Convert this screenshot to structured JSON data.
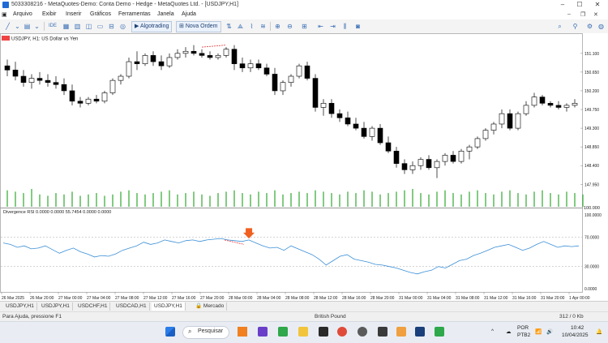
{
  "window": {
    "title": "5033308216 - MetaQuotes-Demo: Conta Demo - Hedge - MetaQuotes Ltd. - [USDJPY,H1]",
    "minimize": "–",
    "maximize": "☐",
    "close": "✕"
  },
  "menu": {
    "items": [
      "Arquivo",
      "Exibir",
      "Inserir",
      "Gráficos",
      "Ferramentas",
      "Janela",
      "Ajuda"
    ],
    "controls": {
      "minimize": "–",
      "restore": "❐",
      "close": "✕"
    }
  },
  "toolbar": {
    "algotrading_label": "Algotrading",
    "new_order_label": "Nova Ordem",
    "accent": "#1d3f72"
  },
  "chart": {
    "header": "USDJPY, H1: US Dollar vs Yen",
    "price_labels": [
      "151.100",
      "150.650",
      "150.200",
      "149.750",
      "149.300",
      "148.850",
      "148.400",
      "147.950"
    ],
    "volume_scale": "100.000",
    "indicator_header": "Divergence RSI 0.0000 0.0000 55.7454 0.0000 0.0000",
    "indicator_scale": [
      "100.0000",
      "70.0000",
      "30.0000",
      "0.0000"
    ],
    "time_labels": [
      "26 Mar 2025",
      "26 Mar 20:00",
      "27 Mar 00:00",
      "27 Mar 04:00",
      "27 Mar 08:00",
      "27 Mar 12:00",
      "27 Mar 16:00",
      "27 Mar 20:00",
      "28 Mar 00:00",
      "28 Mar 04:00",
      "28 Mar 08:00",
      "28 Mar 12:00",
      "28 Mar 16:00",
      "28 Mar 20:00",
      "31 Mar 00:00",
      "31 Mar 04:00",
      "31 Mar 08:00",
      "31 Mar 12:00",
      "31 Mar 16:00",
      "31 Mar 20:00",
      "1 Apr 00:00"
    ],
    "colors": {
      "bull": "#ffffff",
      "bear": "#000000",
      "volume": "#2ea82e",
      "rsi": "#3b8fd6",
      "divergence": "#e33a3a",
      "arrow": "#f06020"
    }
  },
  "chart_data": {
    "type": "candlestick",
    "candles": [
      {
        "o": 150.8,
        "h": 150.95,
        "l": 150.55,
        "c": 150.7
      },
      {
        "o": 150.7,
        "h": 150.9,
        "l": 150.45,
        "c": 150.55
      },
      {
        "o": 150.55,
        "h": 150.7,
        "l": 150.3,
        "c": 150.4
      },
      {
        "o": 150.4,
        "h": 150.6,
        "l": 150.25,
        "c": 150.5
      },
      {
        "o": 150.5,
        "h": 150.65,
        "l": 150.35,
        "c": 150.45
      },
      {
        "o": 150.45,
        "h": 150.6,
        "l": 150.3,
        "c": 150.4
      },
      {
        "o": 150.4,
        "h": 150.55,
        "l": 150.25,
        "c": 150.35
      },
      {
        "o": 150.35,
        "h": 150.5,
        "l": 150.1,
        "c": 150.2
      },
      {
        "o": 150.2,
        "h": 150.35,
        "l": 149.85,
        "c": 149.95
      },
      {
        "o": 149.95,
        "h": 150.05,
        "l": 149.8,
        "c": 149.9
      },
      {
        "o": 149.9,
        "h": 150.05,
        "l": 149.85,
        "c": 150.0
      },
      {
        "o": 150.0,
        "h": 150.1,
        "l": 149.9,
        "c": 149.95
      },
      {
        "o": 149.95,
        "h": 150.2,
        "l": 149.9,
        "c": 150.15
      },
      {
        "o": 150.15,
        "h": 150.5,
        "l": 150.1,
        "c": 150.45
      },
      {
        "o": 150.45,
        "h": 150.6,
        "l": 150.35,
        "c": 150.55
      },
      {
        "o": 150.55,
        "h": 151.0,
        "l": 150.5,
        "c": 150.9
      },
      {
        "o": 150.9,
        "h": 151.15,
        "l": 150.7,
        "c": 150.85
      },
      {
        "o": 150.85,
        "h": 151.1,
        "l": 150.8,
        "c": 151.05
      },
      {
        "o": 151.05,
        "h": 151.15,
        "l": 150.8,
        "c": 150.9
      },
      {
        "o": 150.9,
        "h": 151.05,
        "l": 150.7,
        "c": 150.8
      },
      {
        "o": 150.8,
        "h": 151.1,
        "l": 150.75,
        "c": 151.0
      },
      {
        "o": 151.0,
        "h": 151.2,
        "l": 150.95,
        "c": 151.1
      },
      {
        "o": 151.1,
        "h": 151.25,
        "l": 151.0,
        "c": 151.15
      },
      {
        "o": 151.15,
        "h": 151.3,
        "l": 151.05,
        "c": 151.1
      },
      {
        "o": 151.1,
        "h": 151.2,
        "l": 151.0,
        "c": 151.05
      },
      {
        "o": 151.05,
        "h": 151.15,
        "l": 150.95,
        "c": 151.0
      },
      {
        "o": 151.0,
        "h": 151.1,
        "l": 150.95,
        "c": 151.05
      },
      {
        "o": 151.05,
        "h": 151.25,
        "l": 151.0,
        "c": 151.2
      },
      {
        "o": 151.2,
        "h": 151.3,
        "l": 150.7,
        "c": 150.85
      },
      {
        "o": 150.85,
        "h": 151.0,
        "l": 150.65,
        "c": 150.75
      },
      {
        "o": 150.75,
        "h": 150.95,
        "l": 150.65,
        "c": 150.85
      },
      {
        "o": 150.85,
        "h": 150.95,
        "l": 150.7,
        "c": 150.75
      },
      {
        "o": 150.75,
        "h": 150.85,
        "l": 150.55,
        "c": 150.6
      },
      {
        "o": 150.6,
        "h": 150.75,
        "l": 150.1,
        "c": 150.2
      },
      {
        "o": 150.2,
        "h": 150.45,
        "l": 150.1,
        "c": 150.4
      },
      {
        "o": 150.4,
        "h": 150.6,
        "l": 150.3,
        "c": 150.55
      },
      {
        "o": 150.55,
        "h": 150.85,
        "l": 150.5,
        "c": 150.8
      },
      {
        "o": 150.8,
        "h": 150.9,
        "l": 150.45,
        "c": 150.5
      },
      {
        "o": 150.5,
        "h": 150.6,
        "l": 149.7,
        "c": 149.8
      },
      {
        "o": 149.8,
        "h": 150.0,
        "l": 149.6,
        "c": 149.9
      },
      {
        "o": 149.9,
        "h": 150.0,
        "l": 149.55,
        "c": 149.65
      },
      {
        "o": 149.65,
        "h": 149.75,
        "l": 149.45,
        "c": 149.55
      },
      {
        "o": 149.55,
        "h": 149.7,
        "l": 149.35,
        "c": 149.4
      },
      {
        "o": 149.4,
        "h": 149.55,
        "l": 149.25,
        "c": 149.3
      },
      {
        "o": 149.3,
        "h": 149.45,
        "l": 149.05,
        "c": 149.1
      },
      {
        "o": 149.1,
        "h": 149.35,
        "l": 149.0,
        "c": 149.3
      },
      {
        "o": 149.3,
        "h": 149.4,
        "l": 148.9,
        "c": 148.95
      },
      {
        "o": 148.95,
        "h": 149.1,
        "l": 148.7,
        "c": 148.75
      },
      {
        "o": 148.75,
        "h": 148.85,
        "l": 148.35,
        "c": 148.45
      },
      {
        "o": 148.45,
        "h": 148.55,
        "l": 148.2,
        "c": 148.3
      },
      {
        "o": 148.3,
        "h": 148.5,
        "l": 148.2,
        "c": 148.4
      },
      {
        "o": 148.4,
        "h": 148.6,
        "l": 148.3,
        "c": 148.55
      },
      {
        "o": 148.55,
        "h": 148.65,
        "l": 148.3,
        "c": 148.35
      },
      {
        "o": 148.35,
        "h": 148.55,
        "l": 148.1,
        "c": 148.5
      },
      {
        "o": 148.5,
        "h": 148.7,
        "l": 148.4,
        "c": 148.65
      },
      {
        "o": 148.65,
        "h": 148.75,
        "l": 148.45,
        "c": 148.5
      },
      {
        "o": 148.5,
        "h": 148.8,
        "l": 148.45,
        "c": 148.75
      },
      {
        "o": 148.75,
        "h": 148.9,
        "l": 148.55,
        "c": 148.85
      },
      {
        "o": 148.85,
        "h": 149.1,
        "l": 148.8,
        "c": 149.05
      },
      {
        "o": 149.05,
        "h": 149.3,
        "l": 149.0,
        "c": 149.25
      },
      {
        "o": 149.25,
        "h": 149.45,
        "l": 149.15,
        "c": 149.4
      },
      {
        "o": 149.4,
        "h": 149.75,
        "l": 149.3,
        "c": 149.65
      },
      {
        "o": 149.65,
        "h": 149.75,
        "l": 149.25,
        "c": 149.3
      },
      {
        "o": 149.3,
        "h": 149.7,
        "l": 149.25,
        "c": 149.65
      },
      {
        "o": 149.65,
        "h": 149.95,
        "l": 149.6,
        "c": 149.85
      },
      {
        "o": 149.85,
        "h": 150.15,
        "l": 149.8,
        "c": 150.05
      },
      {
        "o": 150.05,
        "h": 150.1,
        "l": 149.85,
        "c": 149.9
      },
      {
        "o": 149.9,
        "h": 149.95,
        "l": 149.8,
        "c": 149.85
      },
      {
        "o": 149.85,
        "h": 149.95,
        "l": 149.75,
        "c": 149.8
      },
      {
        "o": 149.8,
        "h": 149.9,
        "l": 149.7,
        "c": 149.85
      },
      {
        "o": 149.85,
        "h": 150.0,
        "l": 149.8,
        "c": 149.9
      }
    ],
    "ylim": [
      147.8,
      151.35
    ],
    "volume": [
      60,
      55,
      50,
      65,
      45,
      40,
      50,
      45,
      55,
      40,
      45,
      50,
      40,
      45,
      55,
      60,
      50,
      45,
      50,
      55,
      60,
      45,
      50,
      55,
      45,
      40,
      50,
      55,
      60,
      50,
      45,
      55,
      50,
      60,
      45,
      50,
      55,
      50,
      60,
      55,
      50,
      45,
      55,
      50,
      60,
      55,
      45,
      50,
      55,
      60,
      65,
      50,
      45,
      55,
      60,
      50,
      45,
      55,
      60,
      50,
      45,
      55,
      60,
      50,
      45,
      55,
      60,
      50,
      45,
      55,
      50,
      45
    ],
    "rsi": {
      "ylim": [
        0,
        100
      ],
      "levels": [
        70,
        30
      ],
      "values": [
        62,
        60,
        56,
        58,
        54,
        55,
        58,
        53,
        48,
        52,
        55,
        50,
        47,
        43,
        45,
        44,
        47,
        52,
        55,
        58,
        63,
        60,
        62,
        66,
        64,
        62,
        65,
        66,
        64,
        66,
        67,
        68,
        66,
        65,
        64,
        66,
        62,
        58,
        55,
        56,
        52,
        58,
        54,
        50,
        46,
        40,
        32,
        38,
        44,
        46,
        40,
        38,
        36,
        33,
        32,
        30,
        28,
        25,
        22,
        20,
        23,
        25,
        30,
        28,
        33,
        38,
        40,
        45,
        48,
        52,
        56,
        58,
        60,
        56,
        52,
        55,
        60,
        64,
        60,
        56,
        58,
        57,
        58
      ]
    }
  },
  "tabs": [
    "USDJPY,H1",
    "USDJPY,H1",
    "USDCHF,H1",
    "USDCAD,H1",
    "USDJPY,H1",
    "Mercado"
  ],
  "status": {
    "help": "Para Ajuda, pressione F1",
    "symbol": "British Pound",
    "signal": "312 / 0 Kb"
  },
  "taskbar": {
    "search": "Pesquisar",
    "lang": "POR",
    "layout": "PTB2",
    "time": "10:42",
    "date": "10/04/2025"
  }
}
